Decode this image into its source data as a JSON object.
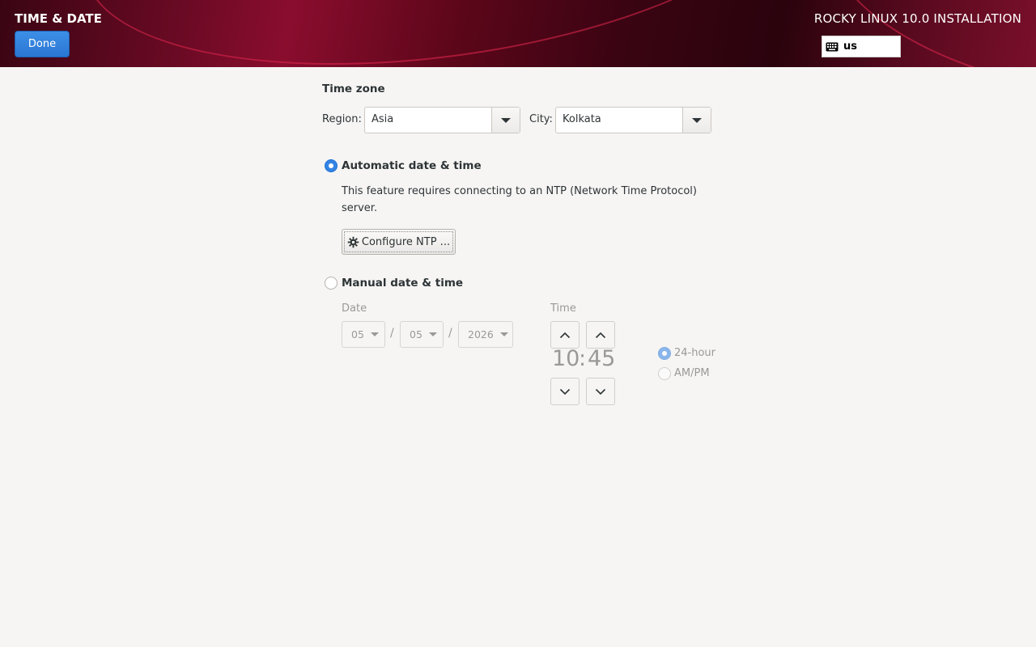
{
  "header": {
    "spoke_title": "TIME & DATE",
    "done_label": "Done",
    "product_title": "ROCKY LINUX 10.0 INSTALLATION",
    "keyboard_layout": "us",
    "keyboard_icon": "keyboard-icon"
  },
  "timezone": {
    "title": "Time zone",
    "region_label": "Region:",
    "region_value": "Asia",
    "city_label": "City:",
    "city_value": "Kolkata"
  },
  "automatic": {
    "label": "Automatic date & time",
    "selected": true,
    "description_line1": "This feature requires connecting to an NTP (Network Time Protocol)",
    "description_line2": "server.",
    "configure_label": "Configure NTP ...",
    "configure_icon": "gear-icon"
  },
  "manual": {
    "label": "Manual date & time",
    "selected": false,
    "date_label": "Date",
    "month": "05",
    "day": "05",
    "year": "2026",
    "date_separator": "/",
    "time_label": "Time",
    "hours": "10",
    "minutes": "45",
    "time_separator": ":",
    "format_24": "24-hour",
    "format_ampm": "AM/PM",
    "format_selected": "24-hour"
  },
  "colors": {
    "accent": "#3584e4",
    "header_dark": "#3a0513",
    "header_red": "#8a0d2e"
  }
}
